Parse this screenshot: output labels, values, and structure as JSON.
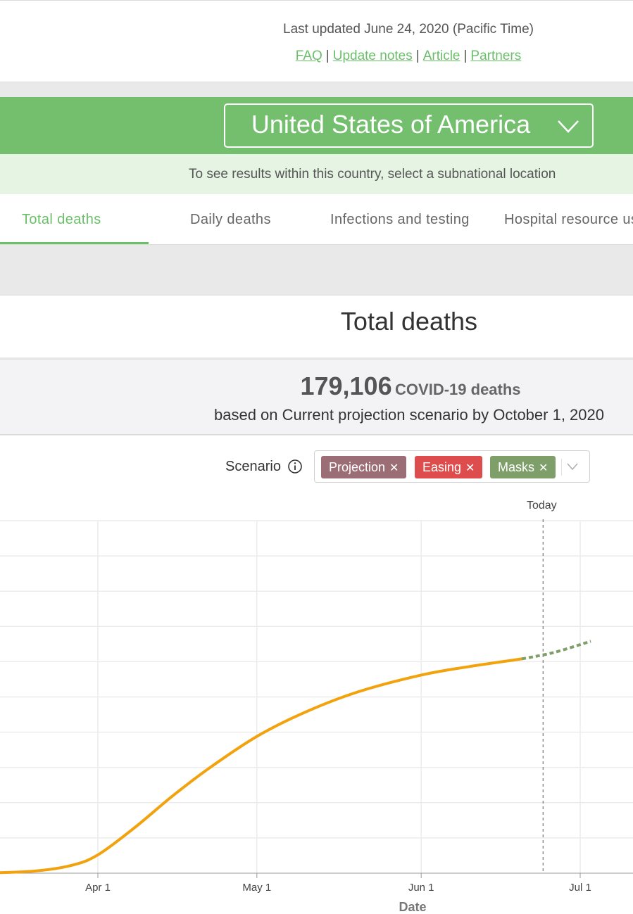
{
  "header": {
    "last_updated": "Last updated June 24, 2020 (Pacific Time)",
    "links": [
      "FAQ",
      "Update notes",
      "Article",
      "Partners"
    ],
    "separator": "|"
  },
  "location": {
    "selected": "United States of America",
    "hint": "To see results within this country, select a subnational location"
  },
  "tabs": [
    {
      "label": "Total deaths",
      "active": true
    },
    {
      "label": "Daily deaths",
      "active": false
    },
    {
      "label": "Infections and testing",
      "active": false
    },
    {
      "label": "Hospital resource use",
      "active": false
    }
  ],
  "panel": {
    "title": "Total deaths",
    "summary_count": "179,106",
    "summary_unit": "COVID-19 deaths",
    "summary_basis": "based on Current projection scenario by October 1, 2020"
  },
  "scenario": {
    "label": "Scenario",
    "chips": [
      {
        "label": "Projection",
        "color": "#9b6e76"
      },
      {
        "label": "Easing",
        "color": "#de4d4d"
      },
      {
        "label": "Masks",
        "color": "#7e9f6a"
      }
    ]
  },
  "colors": {
    "brand_green": "#73bf6e",
    "link_green": "#6abf69",
    "actual_line": "#f2a20c",
    "projection_line": "#7e9f6a"
  },
  "chart_data": {
    "type": "line",
    "title": "",
    "xlabel": "Date",
    "ylabel": "",
    "x_ticks": [
      "Apr 1",
      "May 1",
      "Jun 1",
      "Jul 1"
    ],
    "today_label": "Today",
    "today_date": "2020-06-24",
    "grid": true,
    "series": [
      {
        "kind": "actual",
        "x": [
          "2020-03-01",
          "2020-03-10",
          "2020-03-20",
          "2020-03-27",
          "2020-04-01",
          "2020-04-08",
          "2020-04-15",
          "2020-04-22",
          "2020-05-01",
          "2020-05-10",
          "2020-05-20",
          "2020-06-01",
          "2020-06-10",
          "2020-06-20"
        ],
        "y": [
          0,
          0.02,
          0.3,
          1.1,
          2.6,
          6.5,
          10.9,
          14.9,
          19.4,
          22.8,
          25.7,
          28.1,
          29.3,
          30.4
        ]
      },
      {
        "kind": "projection",
        "x": [
          "2020-06-20",
          "2020-06-26",
          "2020-07-03"
        ],
        "y": [
          30.4,
          31.3,
          32.9
        ]
      }
    ]
  }
}
